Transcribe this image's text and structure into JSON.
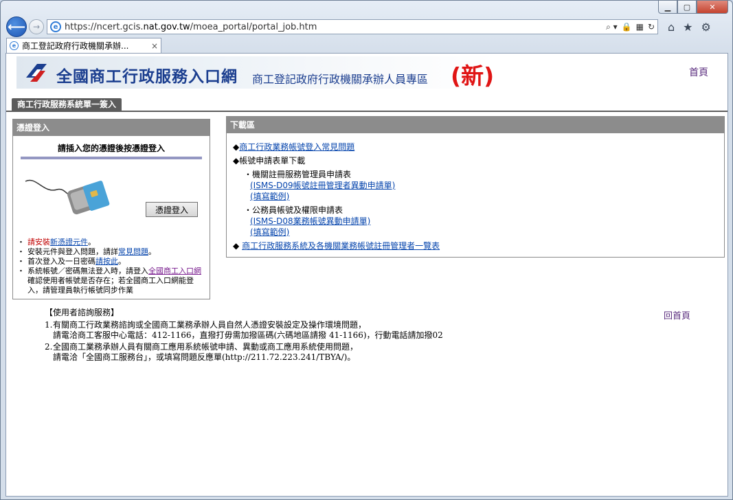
{
  "browser": {
    "url_prefix": "https://ncert.gcis.",
    "url_host": "nat.gov.tw",
    "url_path": "/moea_portal/portal_job.htm",
    "tab_title": "商工登記政府行政機關承辦...",
    "tab_close": "×",
    "window_buttons": {
      "minimize": "▁",
      "maximize": "▢",
      "close": "✕"
    },
    "addr_icons": {
      "search": "⌕ ▾",
      "lock": "🔒",
      "compat": "▦",
      "refresh": "↻"
    },
    "tools": {
      "home": "⌂",
      "favorites": "★",
      "settings": "⚙"
    }
  },
  "header": {
    "logo_main": "全國商工行政服務入口網",
    "logo_sub": "商工登記政府行政機關承辦人員專區",
    "logo_new": "(新)",
    "home_link": "首頁"
  },
  "main_tab": "商工行政服務系統單一簽入",
  "cert_panel": {
    "title": "憑證登入",
    "instruction": "請插入您的憑證後按憑證登入",
    "login_button": "憑證登入",
    "notes": [
      {
        "bullet": "・",
        "pre": "請安裝",
        "link": "新憑證元件",
        "post": "。"
      },
      {
        "bullet": "・",
        "pre": "安裝元件與登入問題，請詳",
        "link": "常見問題",
        "post": "。"
      },
      {
        "bullet": "・",
        "pre": "首次登入及一日密碼",
        "link": "請按此",
        "post": "。"
      },
      {
        "bullet": "・",
        "pre": "系統帳號／密碼無法登入時，請登入",
        "link": "全國商工入口網",
        "post": "確認使用者帳號是否存在；若全國商工入口網能登入，請管理員執行帳號同步作業"
      }
    ]
  },
  "download": {
    "title": "下載區",
    "items": {
      "faq_link": "商工行政業務帳號登入常見問題",
      "forms_heading": "帳號申請表單下載",
      "form1_label": "機關註冊服務管理員申請表",
      "form1_link": "(ISMS-D09帳號註冊管理者異動申請單)",
      "form1_example": "(填寫範例)",
      "form2_label": "公務員帳號及權限申請表",
      "form2_link": "(ISMS-D08業務帳號異動申請單)",
      "form2_example": "(填寫範例)",
      "admin_list_link": "商工行政服務系統及各機關業務帳號註冊管理者一覽表"
    },
    "diamond": "◆",
    "dot": "・"
  },
  "service": {
    "title": "【使用者諮詢服務】",
    "items": [
      {
        "num": "1.",
        "line1": "有關商工行政業務諮詢或全國商工業務承辦人員自然人憑證安裝設定及操作環境問題，",
        "line2": "請電洽商工客服中心電話：412-1166，直撥打毋需加撥區碼(六碼地區請撥 41-1166)，行動電話請加撥02"
      },
      {
        "num": "2.",
        "line1": "全國商工業務承辦人員有關商工應用系統帳號申請、異動或商工應用系統使用問題，",
        "line2": "請電洽「全國商工服務台」，或填寫問題反應單(http://211.72.223.241/TBYA/)。"
      }
    ],
    "back_to_top": "回首頁"
  }
}
